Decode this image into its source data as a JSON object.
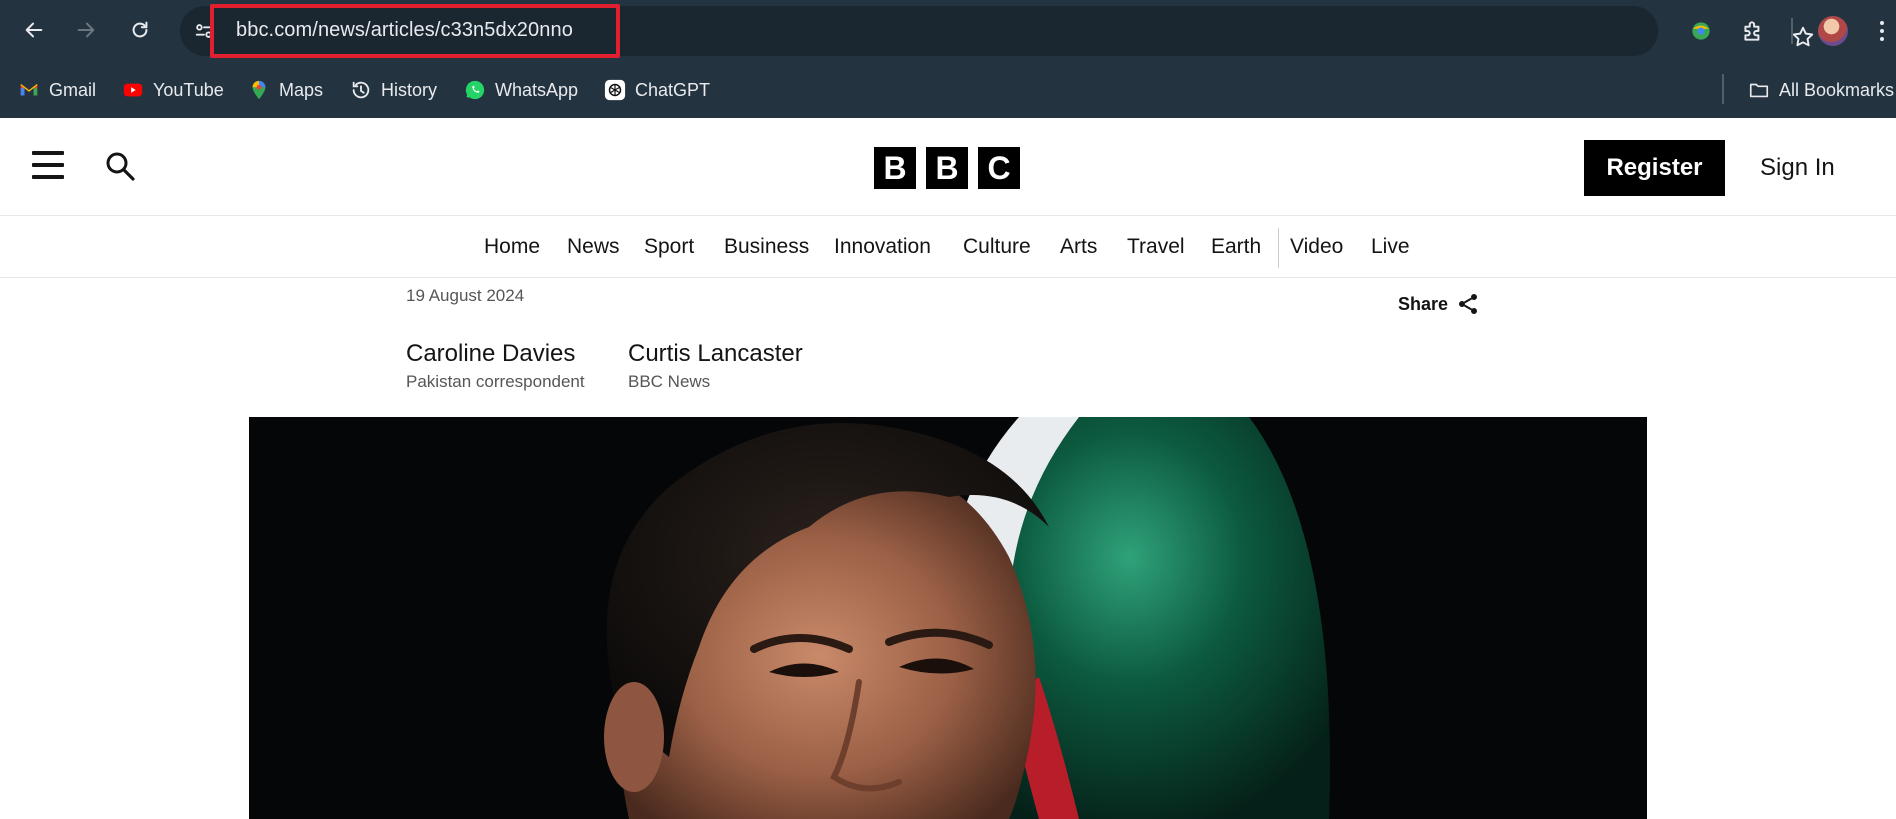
{
  "browser": {
    "url": "bbc.com/news/articles/c33n5dx20nno",
    "bookmarks": [
      {
        "label": "Gmail",
        "icon": "gmail-icon"
      },
      {
        "label": "YouTube",
        "icon": "youtube-icon"
      },
      {
        "label": "Maps",
        "icon": "maps-icon"
      },
      {
        "label": "History",
        "icon": "history-icon"
      },
      {
        "label": "WhatsApp",
        "icon": "whatsapp-icon"
      },
      {
        "label": "ChatGPT",
        "icon": "chatgpt-icon"
      }
    ],
    "all_bookmarks_label": "All Bookmarks",
    "colors": {
      "chrome_bg": "#233340",
      "omnibox_bg": "#1a2630",
      "highlight": "#e0202f"
    }
  },
  "header": {
    "logo_letters": [
      "B",
      "B",
      "C"
    ],
    "register_label": "Register",
    "signin_label": "Sign In"
  },
  "nav": {
    "items": [
      "Home",
      "News",
      "Sport",
      "Business",
      "Innovation",
      "Culture",
      "Arts",
      "Travel",
      "Earth",
      "Video",
      "Live"
    ]
  },
  "article": {
    "date": "19 August 2024",
    "share_label": "Share",
    "authors": [
      {
        "name": "Caroline Davies",
        "role": "Pakistan correspondent"
      },
      {
        "name": "Curtis Lancaster",
        "role": "BBC News"
      }
    ]
  }
}
